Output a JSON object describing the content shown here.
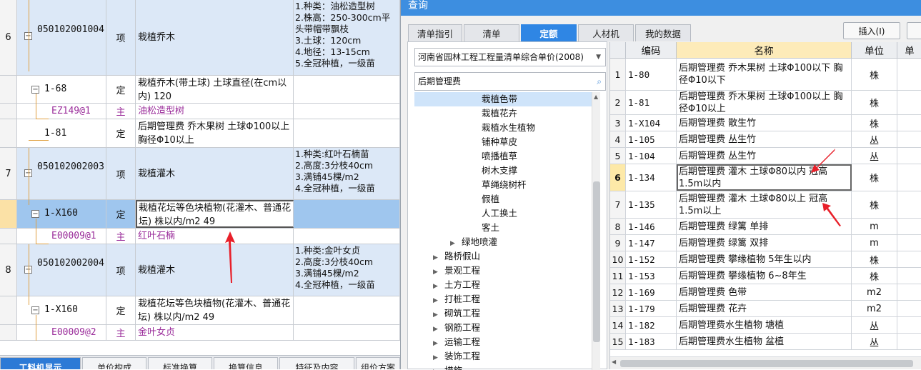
{
  "left": {
    "rows": [
      {
        "idx": "6",
        "code": "050102001004",
        "type": "项",
        "name": "栽植乔木",
        "features": "1.种类：油松造型树\n2.株高：250-300cm平\n头带帽带飘枝\n3.土球：120cm\n4.地径：13-15cm\n5.全冠种植，一级苗"
      },
      {
        "code": "1-68",
        "type": "定",
        "name": "栽植乔木(带土球) 土球直径(在cm以内) 120"
      },
      {
        "code": "EZ149@1",
        "type": "主",
        "name": "油松造型树"
      },
      {
        "code": "1-81",
        "type": "定",
        "name": "后期管理费 乔木果树 土球Φ100以上 胸径Φ10以上"
      },
      {
        "idx": "7",
        "code": "050102002003",
        "type": "项",
        "name": "栽植灌木",
        "features": "1.种类:红叶石楠苗\n2.高度:3分枝40cm\n3.满铺45棵/m2\n4.全冠种植，一级苗"
      },
      {
        "code": "1-X160",
        "type": "定",
        "name": "栽植花坛等色块植物(花灌木、普通花坛) 株以内/m2 49"
      },
      {
        "code": "E00009@1",
        "type": "主",
        "name": "红叶石楠"
      },
      {
        "idx": "8",
        "code": "050102002004",
        "type": "项",
        "name": "栽植灌木",
        "features": "1.种类:金叶女贞\n2.高度:3分枝40cm\n3.满铺45棵/m2\n4.全冠种植，一级苗"
      },
      {
        "code": "1-X160",
        "type": "定",
        "name": "栽植花坛等色块植物(花灌木、普通花坛) 株以内/m2 49"
      },
      {
        "code": "E00009@2",
        "type": "主",
        "name": "金叶女贞"
      }
    ],
    "tabs": [
      "工料机显示",
      "单价构成",
      "标准换算",
      "换算信息",
      "特征及内容",
      "组价方案"
    ]
  },
  "dialog": {
    "title": "查询",
    "tabs": [
      "清单指引",
      "清单",
      "定额",
      "人材机",
      "我的数据"
    ],
    "insert_button": "插入(I)",
    "quota_library": "河南省园林工程工程量清单综合单价(2008)",
    "search_value": "后期管理费",
    "tree": [
      {
        "label": "栽植色带",
        "level": 2
      },
      {
        "label": "栽植花卉",
        "level": 2
      },
      {
        "label": "栽植水生植物",
        "level": 2
      },
      {
        "label": "铺种草皮",
        "level": 2
      },
      {
        "label": "喷播植草",
        "level": 2
      },
      {
        "label": "树木支撑",
        "level": 2
      },
      {
        "label": "草绳绕树杆",
        "level": 2
      },
      {
        "label": "假植",
        "level": 2
      },
      {
        "label": "人工换土",
        "level": 2
      },
      {
        "label": "客土",
        "level": 2
      },
      {
        "label": "绿地喷灌",
        "level": 1
      },
      {
        "label": "路桥假山",
        "level": 0
      },
      {
        "label": "景观工程",
        "level": 0
      },
      {
        "label": "土方工程",
        "level": 0
      },
      {
        "label": "打桩工程",
        "level": 0
      },
      {
        "label": "砌筑工程",
        "level": 0
      },
      {
        "label": "钢筋工程",
        "level": 0
      },
      {
        "label": "运输工程",
        "level": 0
      },
      {
        "label": "装饰工程",
        "level": 0
      },
      {
        "label": "措施",
        "level": 0
      }
    ],
    "columns": {
      "code": "编码",
      "name": "名称",
      "unit": "单位",
      "extra": "单"
    },
    "rows": [
      {
        "idx": "1",
        "code": "1-80",
        "name": "后期管理费 乔木果树 土球Φ100以下 胸径Φ10以下",
        "unit": "株"
      },
      {
        "idx": "2",
        "code": "1-81",
        "name": "后期管理费 乔木果树 土球Φ100以上 胸径Φ10以上",
        "unit": "株"
      },
      {
        "idx": "3",
        "code": "1-X104",
        "name": "后期管理费 散生竹",
        "unit": "株"
      },
      {
        "idx": "4",
        "code": "1-105",
        "name": "后期管理费 丛生竹",
        "unit": "丛"
      },
      {
        "idx": "5",
        "code": "1-104",
        "name": "后期管理费 丛生竹",
        "unit": "丛"
      },
      {
        "idx": "6",
        "code": "1-134",
        "name": "后期管理费 灌木 土球Φ80以内 冠高1.5m以内",
        "unit": "株"
      },
      {
        "idx": "7",
        "code": "1-135",
        "name": "后期管理费 灌木 土球Φ80以上 冠高1.5m以上",
        "unit": "株"
      },
      {
        "idx": "8",
        "code": "1-146",
        "name": "后期管理费 绿篱 单排",
        "unit": "m"
      },
      {
        "idx": "9",
        "code": "1-147",
        "name": "后期管理费 绿篱 双排",
        "unit": "m"
      },
      {
        "idx": "10",
        "code": "1-152",
        "name": "后期管理费 攀缘植物 5年生以内",
        "unit": "株"
      },
      {
        "idx": "11",
        "code": "1-153",
        "name": "后期管理费 攀缘植物 6~8年生",
        "unit": "株"
      },
      {
        "idx": "12",
        "code": "1-169",
        "name": "后期管理费 色带",
        "unit": "m2"
      },
      {
        "idx": "13",
        "code": "1-179",
        "name": "后期管理费 花卉",
        "unit": "m2"
      },
      {
        "idx": "14",
        "code": "1-182",
        "name": "后期管理费水生植物 塘植",
        "unit": "丛"
      },
      {
        "idx": "15",
        "code": "1-183",
        "name": "后期管理费水生植物 盆植",
        "unit": "丛"
      }
    ]
  },
  "colors": {
    "accent": "#2f86e4",
    "title_bar": "#3d8ee0",
    "annotation": "#e8202a",
    "main_row": "#dce8f7",
    "selected_row": "#9fc6ee",
    "purple_text": "#9a2c9a"
  }
}
